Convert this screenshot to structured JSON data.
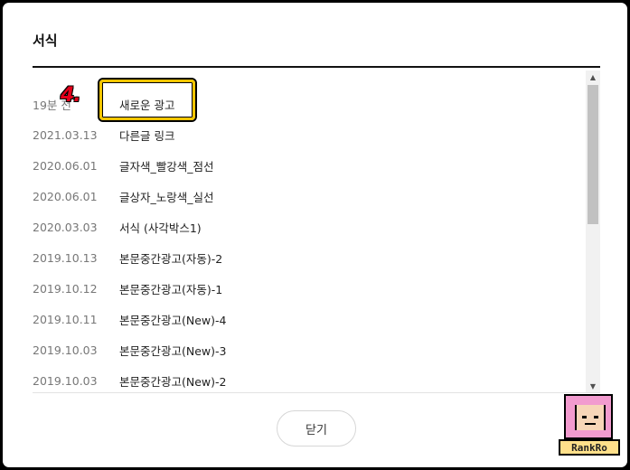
{
  "dialog": {
    "title": "서식",
    "close_label": "닫기"
  },
  "annotation": {
    "step_label": "4."
  },
  "list": {
    "rows": [
      {
        "date": "19분 전",
        "name": "새로운 광고"
      },
      {
        "date": "2021.03.13",
        "name": "다른글 링크"
      },
      {
        "date": "2020.06.01",
        "name": "글자색_빨강색_점선"
      },
      {
        "date": "2020.06.01",
        "name": "글상자_노랑색_실선"
      },
      {
        "date": "2020.03.03",
        "name": "서식 (사각박스1)"
      },
      {
        "date": "2019.10.13",
        "name": "본문중간광고(자동)-2"
      },
      {
        "date": "2019.10.12",
        "name": "본문중간광고(자동)-1"
      },
      {
        "date": "2019.10.11",
        "name": "본문중간광고(New)-4"
      },
      {
        "date": "2019.10.03",
        "name": "본문중간광고(New)-3"
      },
      {
        "date": "2019.10.03",
        "name": "본문중간광고(New)-2"
      }
    ]
  },
  "watermark": {
    "logo_text": "RankRo"
  },
  "colors": {
    "highlight_border": "#f2c500",
    "badge_red": "#e3001b",
    "logo_pink": "#f29bcf"
  }
}
